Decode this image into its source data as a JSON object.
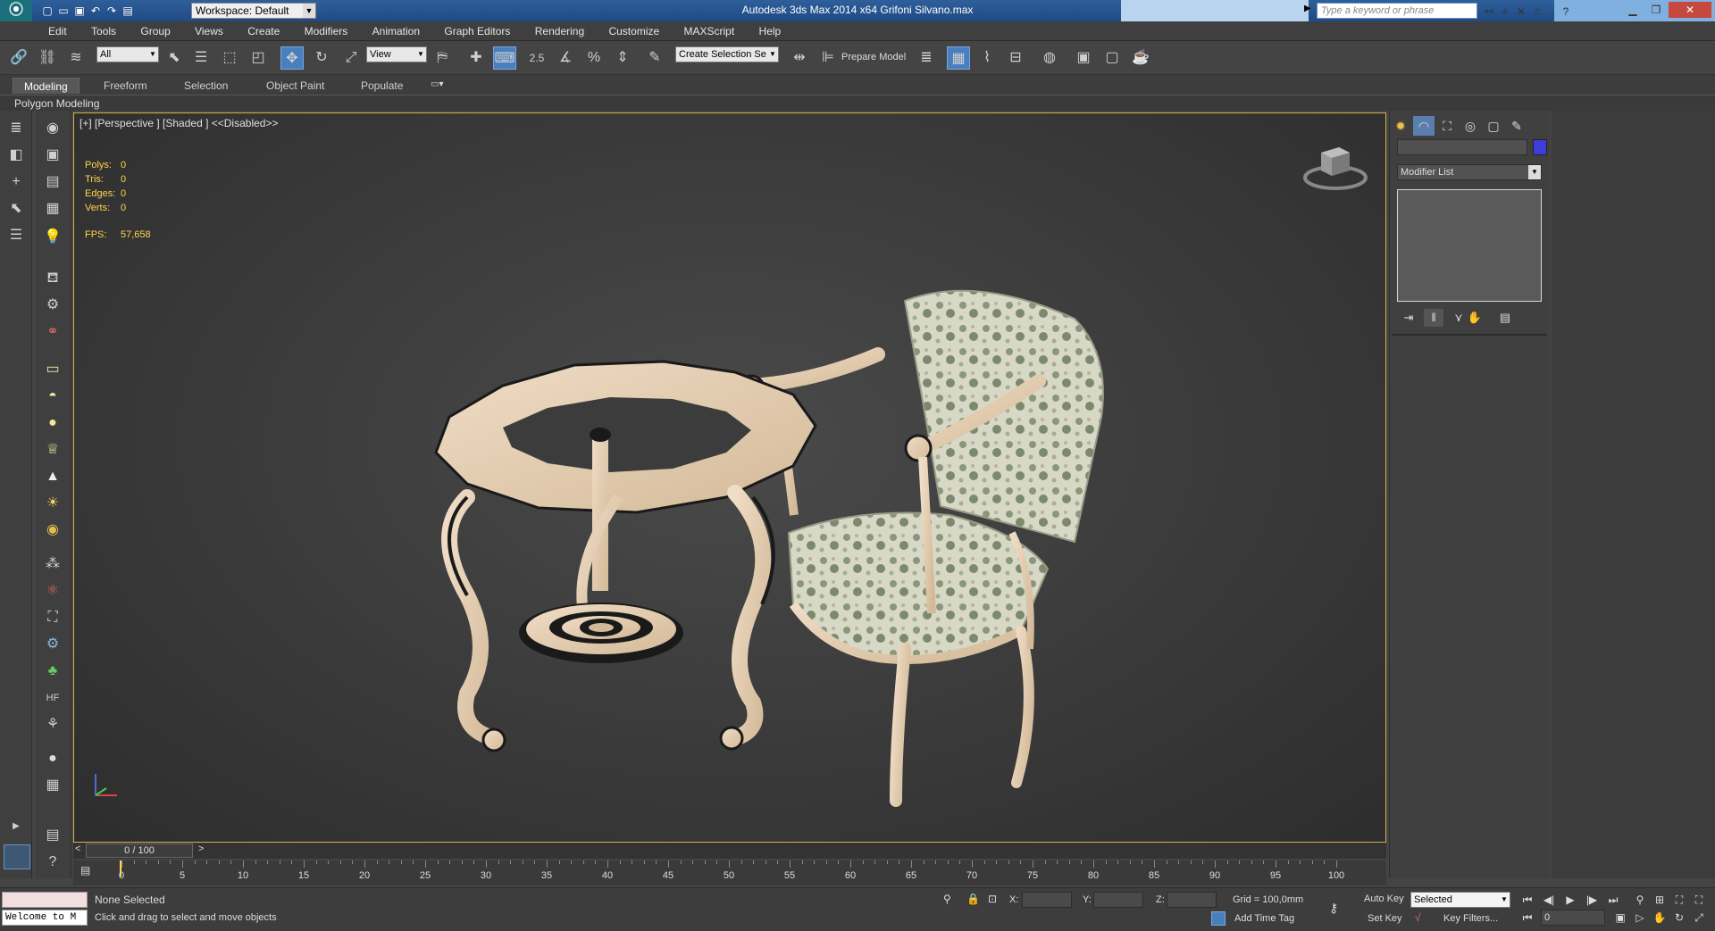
{
  "window": {
    "title": "Autodesk 3ds Max  2014 x64      Grifoni Silvano.max",
    "workspace": "Workspace: Default",
    "search_placeholder": "Type a keyword or phrase"
  },
  "menu": [
    "Edit",
    "Tools",
    "Group",
    "Views",
    "Create",
    "Modifiers",
    "Animation",
    "Graph Editors",
    "Rendering",
    "Customize",
    "MAXScript",
    "Help"
  ],
  "toolbar": {
    "filter_select": "All",
    "ref_coord_select": "View",
    "snap_label": "2.5",
    "named_selection": "Create Selection Se",
    "prepare_model": "Prepare Model"
  },
  "ribbon": {
    "tabs": [
      "Modeling",
      "Freeform",
      "Selection",
      "Object Paint",
      "Populate"
    ],
    "panel_label": "Polygon Modeling"
  },
  "viewport": {
    "label": "[+] [Perspective ] [Shaded ]  <<Disabled>>",
    "stats": [
      {
        "label": "Polys:",
        "value": "0"
      },
      {
        "label": "Tris:",
        "value": "0"
      },
      {
        "label": "Edges:",
        "value": "0"
      },
      {
        "label": "Verts:",
        "value": "0"
      }
    ],
    "fps_label": "FPS:",
    "fps_value": "57,658",
    "colors": {
      "border": "#d8b04a",
      "stats": "#ffd44a",
      "wood": "#e8d3b8",
      "fabric": "#d9d9c6"
    }
  },
  "command_panel": {
    "modifier_list": "Modifier List",
    "swatch_color": "#3e3ed8"
  },
  "timeline": {
    "slider_label": "0 / 100",
    "ticks": [
      "0",
      "5",
      "10",
      "15",
      "20",
      "25",
      "30",
      "35",
      "40",
      "45",
      "50",
      "55",
      "60",
      "65",
      "70",
      "75",
      "80",
      "85",
      "90",
      "95",
      "100"
    ]
  },
  "status": {
    "maxscript_text": "Welcome to M",
    "selection": "None Selected",
    "prompt": "Click and drag to select and move objects",
    "x_label": "X:",
    "y_label": "Y:",
    "z_label": "Z:",
    "grid": "Grid = 100,0mm",
    "add_time_tag": "Add Time Tag",
    "auto_key": "Auto Key",
    "set_key": "Set Key",
    "key_mode": "Selected",
    "key_filters": "Key Filters...",
    "frame": "0"
  }
}
